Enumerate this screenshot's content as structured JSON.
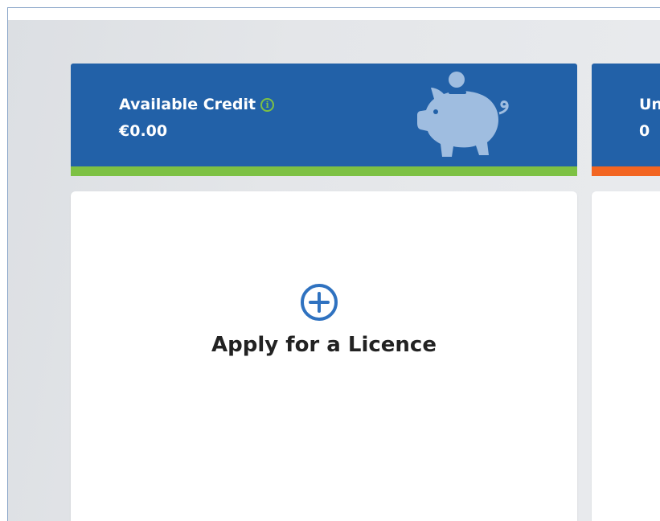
{
  "stats": {
    "credit": {
      "label": "Available Credit",
      "value": "€0.00",
      "accent_color": "#7dc144",
      "icon": "piggy-bank-icon"
    },
    "unpaid": {
      "label": "Un",
      "value": "0",
      "accent_color": "#f26522"
    }
  },
  "actions": {
    "apply": {
      "title": "Apply for a Licence",
      "icon": "plus-circle-icon"
    }
  },
  "colors": {
    "card_blue": "#2261a8",
    "piggy": "#9fbde0",
    "plus": "#2f72c0"
  }
}
